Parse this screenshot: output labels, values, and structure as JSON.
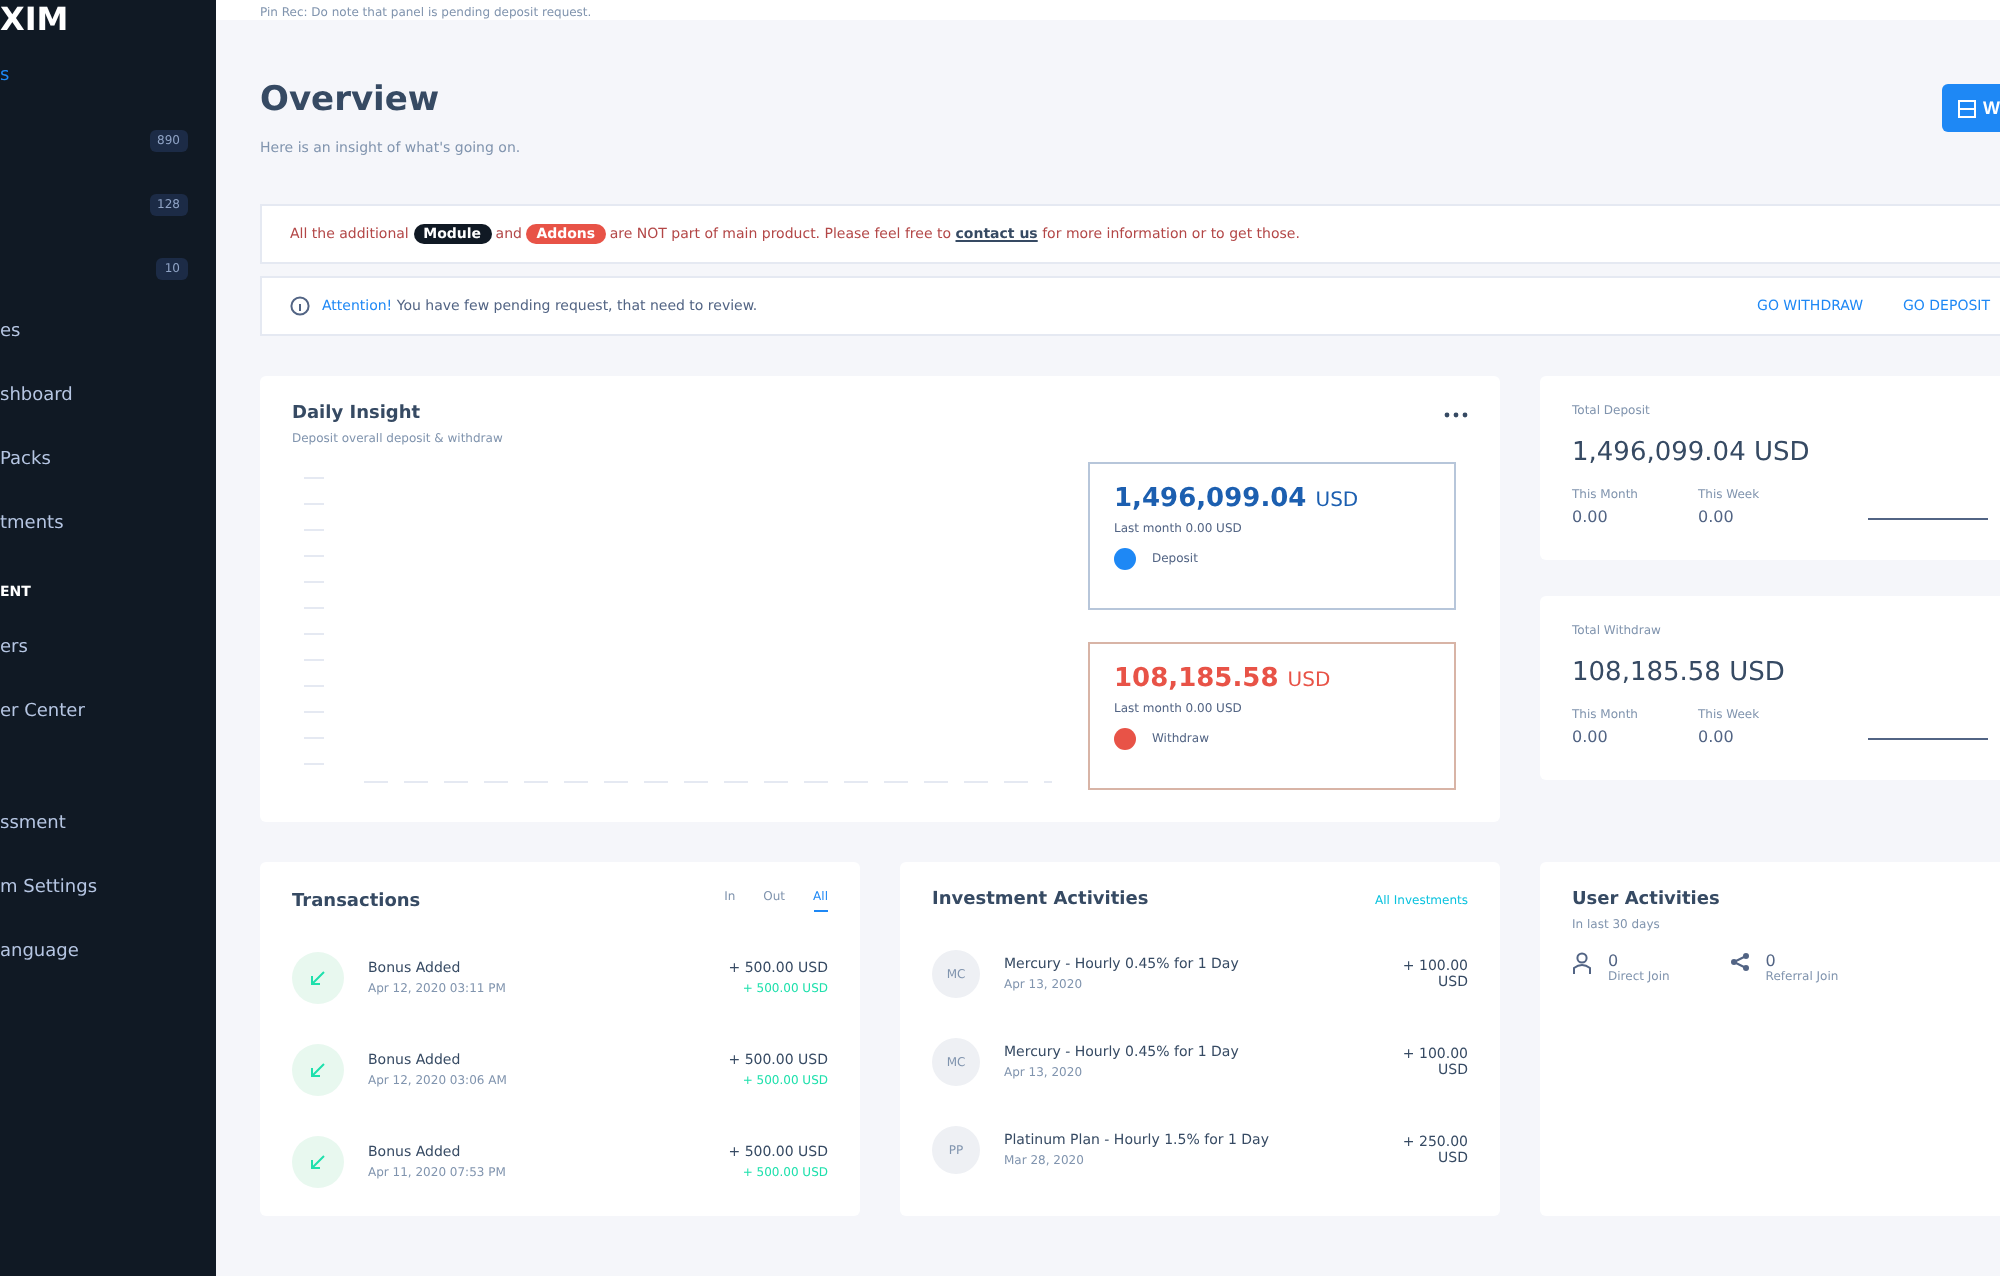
{
  "sidebar": {
    "logo": "XIM",
    "active": {
      "label": "s",
      "selected": true
    },
    "badges": [
      "890",
      "128",
      "10"
    ],
    "items": [
      {
        "label": "es",
        "selected": false
      },
      {
        "label": "shboard",
        "selected": false
      },
      {
        "label": "Packs",
        "selected": false
      },
      {
        "label": "tments",
        "selected": false
      }
    ],
    "section": "ENT",
    "items2": [
      "ers",
      "er Center"
    ],
    "items3": [
      "ssment",
      "m Settings",
      "anguage"
    ]
  },
  "topbar": {
    "notice": "Pin Rec: Do note that panel is pending deposit request."
  },
  "header": {
    "title": "Overview",
    "subtitle": "Here is an insight of what's going on.",
    "button": "W"
  },
  "alert": {
    "text": "All the additional",
    "badge1": "Module",
    "and": "and",
    "badge2": "Addons",
    "rest": "are NOT part of main product. Please feel free to",
    "link": "contact us",
    "tail": "for more information or to get those."
  },
  "attention": {
    "label": "Attention!",
    "text": "You have few pending request, that need to review.",
    "links": [
      "GO WITHDRAW",
      "GO DEPOSIT"
    ]
  },
  "insight": {
    "title": "Daily Insight",
    "subtitle": "Deposit overall deposit & withdraw",
    "boxes": [
      {
        "kind": "deposit",
        "amount": "1,496,099.04",
        "unit": "USD",
        "note": "Last month 0.00 USD",
        "label": "Deposit"
      },
      {
        "kind": "withdraw",
        "amount": "108,185.58",
        "unit": "USD",
        "note": "Last month 0.00 USD",
        "label": "Withdraw"
      }
    ]
  },
  "totals": [
    {
      "title": "Total Deposit",
      "amount": "1,496,099.04 USD",
      "stats": [
        {
          "label": "This Month",
          "value": "0.00"
        },
        {
          "label": "This Week",
          "value": "0.00"
        }
      ]
    },
    {
      "title": "Total Withdraw",
      "amount": "108,185.58 USD",
      "stats": [
        {
          "label": "This Month",
          "value": "0.00"
        },
        {
          "label": "This Week",
          "value": "0.00"
        }
      ]
    }
  ],
  "transactions": {
    "title": "Transactions",
    "tabs": [
      {
        "label": "In",
        "selected": false
      },
      {
        "label": "Out",
        "selected": false
      },
      {
        "label": "All",
        "selected": true
      }
    ],
    "rows": [
      {
        "title": "Bonus Added",
        "date": "Apr 12, 2020 03:11 PM",
        "amount": "+ 500.00 USD",
        "sub": "+ 500.00 USD"
      },
      {
        "title": "Bonus Added",
        "date": "Apr 12, 2020 03:06 AM",
        "amount": "+ 500.00 USD",
        "sub": "+ 500.00 USD"
      },
      {
        "title": "Bonus Added",
        "date": "Apr 11, 2020 07:53 PM",
        "amount": "+ 500.00 USD",
        "sub": "+ 500.00 USD"
      }
    ]
  },
  "investments": {
    "title": "Investment Activities",
    "link": "All Investments",
    "rows": [
      {
        "icon": "MC",
        "title": "Mercury - Hourly 0.45% for 1 Day",
        "date": "Apr 13, 2020",
        "amount": "+ 100.00",
        "unit": "USD"
      },
      {
        "icon": "MC",
        "title": "Mercury - Hourly 0.45% for 1 Day",
        "date": "Apr 13, 2020",
        "amount": "+ 100.00",
        "unit": "USD"
      },
      {
        "icon": "PP",
        "title": "Platinum Plan - Hourly 1.5% for 1 Day",
        "date": "Mar 28, 2020",
        "amount": "+ 250.00",
        "unit": "USD"
      }
    ]
  },
  "users": {
    "title": "User Activities",
    "subtitle": "In last 30 days",
    "stats": [
      {
        "kind": "direct",
        "value": "0",
        "label": "Direct Join"
      },
      {
        "kind": "referral",
        "value": "0",
        "label": "Referral Join"
      }
    ]
  }
}
